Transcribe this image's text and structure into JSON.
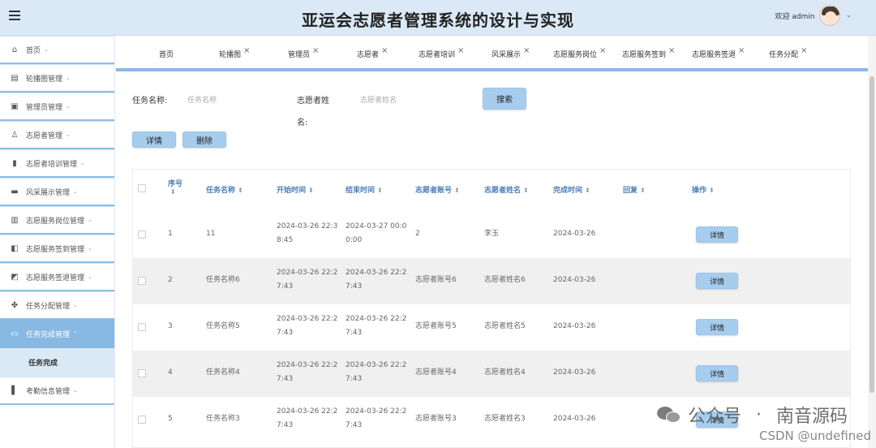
{
  "header": {
    "title": "亚运会志愿者管理系统的设计与实现",
    "welcome": "欢迎 admin",
    "caret": "⌄"
  },
  "sidebar": {
    "items": [
      {
        "label": "首页",
        "icon": "home-icon"
      },
      {
        "label": "轮播图管理",
        "icon": "carousel-icon"
      },
      {
        "label": "管理员管理",
        "icon": "admin-icon"
      },
      {
        "label": "志愿者管理",
        "icon": "volunteer-icon"
      },
      {
        "label": "志愿者培训管理",
        "icon": "training-icon"
      },
      {
        "label": "风采展示管理",
        "icon": "showcase-icon"
      },
      {
        "label": "志愿服务岗位管理",
        "icon": "post-icon"
      },
      {
        "label": "志愿服务签到管理",
        "icon": "signin-icon"
      },
      {
        "label": "志愿服务签退管理",
        "icon": "signout-icon"
      },
      {
        "label": "任务分配管理",
        "icon": "assign-icon"
      },
      {
        "label": "任务完成管理",
        "icon": "complete-icon"
      },
      {
        "label": "考勤信息管理",
        "icon": "attendance-icon"
      }
    ],
    "sub_item": "任务完成"
  },
  "tabs": [
    {
      "label": "首页",
      "closable": false
    },
    {
      "label": "轮播图",
      "closable": true
    },
    {
      "label": "管理员",
      "closable": true
    },
    {
      "label": "志愿者",
      "closable": true
    },
    {
      "label": "志愿者培训",
      "closable": true
    },
    {
      "label": "风采展示",
      "closable": true
    },
    {
      "label": "志愿服务岗位",
      "closable": true
    },
    {
      "label": "志愿服务签到",
      "closable": true
    },
    {
      "label": "志愿服务签退",
      "closable": true
    },
    {
      "label": "任务分配",
      "closable": true
    }
  ],
  "search": {
    "task_name_label": "任务名称:",
    "task_name_placeholder": "任务名称",
    "volunteer_name_label_1": "志愿者姓",
    "volunteer_name_label_2": "名:",
    "volunteer_name_placeholder": "志愿者姓名",
    "search_button": "搜索"
  },
  "actions": {
    "detail": "详情",
    "delete": "删除"
  },
  "table": {
    "columns": [
      "序号",
      "任务名称",
      "开始时间",
      "结束时间",
      "志愿者账号",
      "志愿者姓名",
      "完成时间",
      "回复",
      "操作"
    ],
    "rows": [
      {
        "index": "1",
        "task": "11",
        "start": [
          "2024-03-26 22:3",
          "8:45"
        ],
        "end": [
          "2024-03-27 00:0",
          "0:00"
        ],
        "account": "2",
        "name": "李玉",
        "done": "2024-03-26",
        "reply": ""
      },
      {
        "index": "2",
        "task": "任务名称6",
        "start": [
          "2024-03-26 22:2",
          "7:43"
        ],
        "end": [
          "2024-03-26 22:2",
          "7:43"
        ],
        "account": "志愿者账号6",
        "name": "志愿者姓名6",
        "done": "2024-03-26",
        "reply": ""
      },
      {
        "index": "3",
        "task": "任务名称5",
        "start": [
          "2024-03-26 22:2",
          "7:43"
        ],
        "end": [
          "2024-03-26 22:2",
          "7:43"
        ],
        "account": "志愿者账号5",
        "name": "志愿者姓名5",
        "done": "2024-03-26",
        "reply": ""
      },
      {
        "index": "4",
        "task": "任务名称4",
        "start": [
          "2024-03-26 22:2",
          "7:43"
        ],
        "end": [
          "2024-03-26 22:2",
          "7:43"
        ],
        "account": "志愿者账号4",
        "name": "志愿者姓名4",
        "done": "2024-03-26",
        "reply": ""
      },
      {
        "index": "5",
        "task": "任务名称3",
        "start": [
          "2024-03-26 22:2",
          "7:43"
        ],
        "end": [
          "2024-03-26 22:2",
          "7:43"
        ],
        "account": "志愿者账号3",
        "name": "志愿者姓名3",
        "done": "2024-03-26",
        "reply": ""
      }
    ],
    "row_button": "详情"
  },
  "watermark": {
    "account": "公众号",
    "dot": "·",
    "name": "南音源码",
    "csdn": "CSDN @undefined"
  },
  "colors": {
    "accent": "#87b9e3",
    "header_bg": "#dbe9f7",
    "button_bg": "#a7cdee"
  }
}
